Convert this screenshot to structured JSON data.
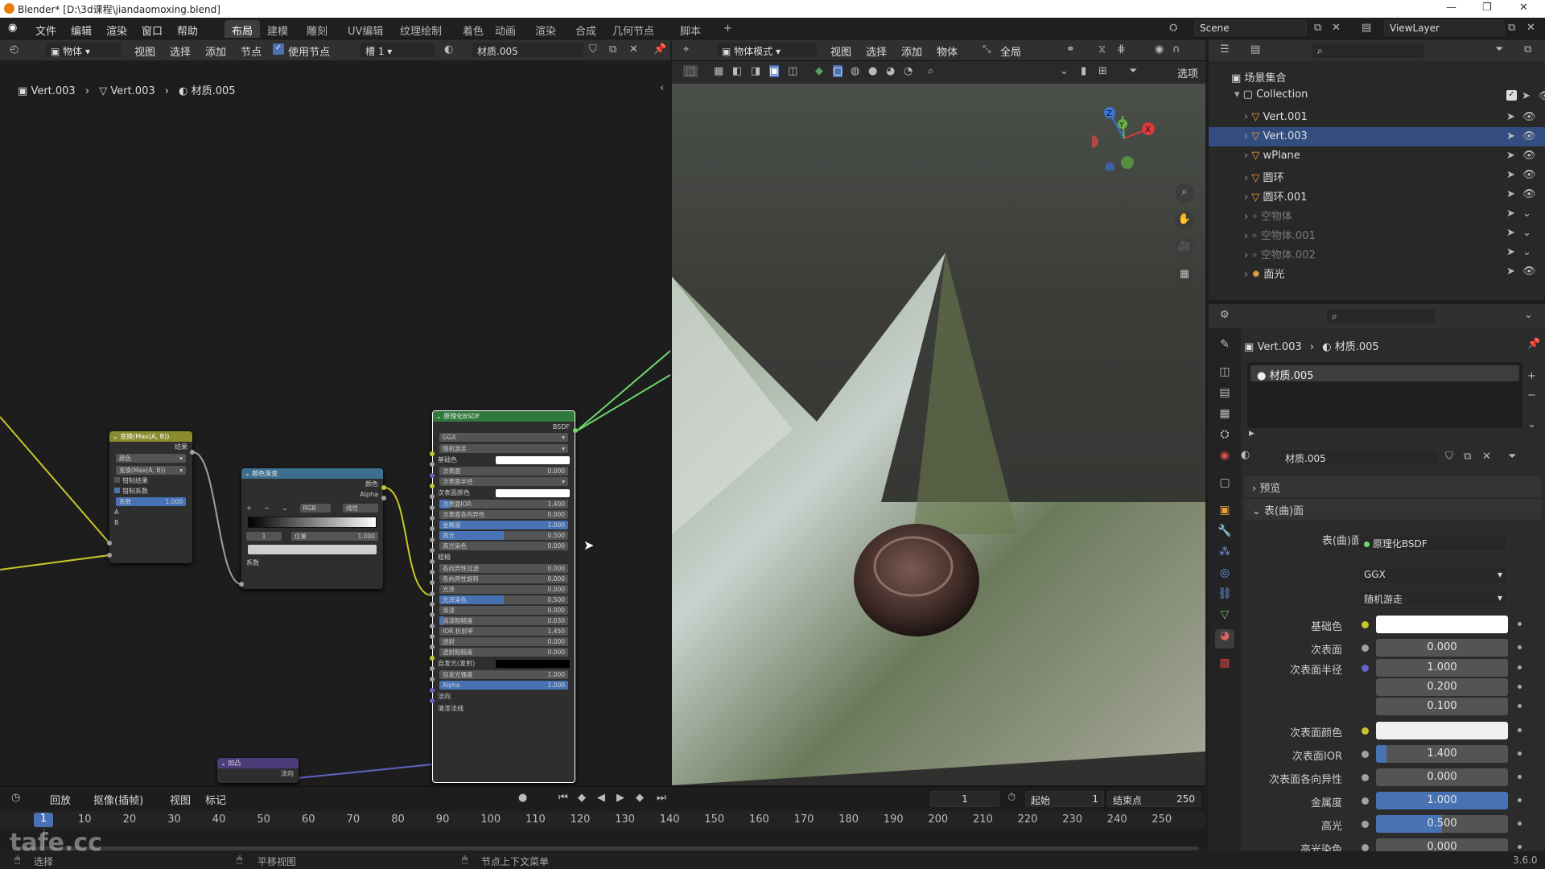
{
  "window": {
    "title": "Blender* [D:\\3d课程\\jiandaomoxing.blend]",
    "minimize": "—",
    "restore": "❐",
    "close": "✕"
  },
  "menu": {
    "items": [
      "文件",
      "编辑",
      "渲染",
      "窗口",
      "帮助"
    ]
  },
  "workspaces": {
    "tabs": [
      "布局",
      "建模",
      "雕刻",
      "UV编辑",
      "纹理绘制",
      "着色",
      "动画",
      "渲染",
      "合成",
      "几何节点",
      "脚本"
    ],
    "active": "布局",
    "add": "+"
  },
  "scene": {
    "label": "Scene",
    "viewlayer": "ViewLayer"
  },
  "node_editor": {
    "header": {
      "type": "物体",
      "menus": [
        "视图",
        "选择",
        "添加",
        "节点"
      ],
      "use_nodes": "使用节点",
      "slot": "槽 1",
      "material": "材质.005"
    },
    "breadcrumb": [
      "Vert.003",
      "Vert.003",
      "材质.005"
    ],
    "math_node": {
      "title": "变换(Max(A, B))",
      "out": "结果",
      "rows": [
        "颜色",
        "变换(Max(A, B))"
      ],
      "check1": "钳制结果",
      "check2": "钳制系数",
      "factor_label": "系数",
      "factor_val": "1.000",
      "in_a": "A",
      "in_b": "B"
    },
    "ramp_node": {
      "title": "颜色渐变",
      "out1": "颜色",
      "out2": "Alpha",
      "mode": "RGB",
      "interp": "线性",
      "index": "1",
      "pos_label": "位置",
      "pos_val": "1.000",
      "in": "系数"
    },
    "bsdf_node": {
      "title": "原理化BSDF",
      "out": "BSDF",
      "dist": "GGX",
      "sss": "随机游走",
      "rows": [
        {
          "l": "基础色",
          "t": "color",
          "c": "#ffffff"
        },
        {
          "l": "次表面",
          "v": "0.000",
          "p": 0
        },
        {
          "l": "次表面半径",
          "t": "menu"
        },
        {
          "l": "次表面颜色",
          "t": "color",
          "c": "#ffffff"
        },
        {
          "l": "次表面IOR",
          "v": "1.400",
          "p": 8
        },
        {
          "l": "次表面各向异性",
          "v": "0.000",
          "p": 0
        },
        {
          "l": "金属度",
          "v": "1.000",
          "p": 100
        },
        {
          "l": "高光",
          "v": "0.500",
          "p": 50
        },
        {
          "l": "高光染色",
          "v": "0.000",
          "p": 0
        },
        {
          "l": "粗糙",
          "t": "label"
        },
        {
          "l": "各向异性过滤",
          "v": "0.000",
          "p": 0
        },
        {
          "l": "各向异性旋转",
          "v": "0.000",
          "p": 0
        },
        {
          "l": "光泽",
          "v": "0.000",
          "p": 0
        },
        {
          "l": "光泽染色",
          "v": "0.500",
          "p": 50
        },
        {
          "l": "清漆",
          "v": "0.000",
          "p": 0
        },
        {
          "l": "清漆粗糙度",
          "v": "0.030",
          "p": 3
        },
        {
          "l": "IOR 折射率",
          "v": "1.450",
          "p": 0
        },
        {
          "l": "透射",
          "v": "0.000",
          "p": 0
        },
        {
          "l": "透射粗糙度",
          "v": "0.000",
          "p": 0
        },
        {
          "l": "自发光(发射)",
          "t": "color",
          "c": "#000000"
        },
        {
          "l": "自发光强度",
          "v": "1.000",
          "p": 0
        },
        {
          "l": "Alpha",
          "v": "1.000",
          "p": 100
        },
        {
          "l": "法向",
          "t": "label"
        },
        {
          "l": "清漆法线",
          "t": "label"
        }
      ]
    },
    "bump_node": {
      "title": "凹凸",
      "out": "法向"
    }
  },
  "viewport": {
    "mode": "物体模式",
    "menus": [
      "视图",
      "选择",
      "添加",
      "物体"
    ],
    "transform": "全局",
    "options": "选项",
    "gizmo": {
      "x": "X",
      "y": "Y",
      "z": "Z"
    }
  },
  "outliner": {
    "root": "场景集合",
    "collection": "Collection",
    "items": [
      {
        "name": "Vert.001",
        "sel": false,
        "dim": false,
        "ico": "mesh"
      },
      {
        "name": "Vert.003",
        "sel": true,
        "dim": false,
        "ico": "mesh"
      },
      {
        "name": "wPlane",
        "sel": false,
        "dim": false,
        "ico": "mesh"
      },
      {
        "name": "圆环",
        "sel": false,
        "dim": false,
        "ico": "mesh"
      },
      {
        "name": "圆环.001",
        "sel": false,
        "dim": false,
        "ico": "mesh"
      },
      {
        "name": "空物体",
        "sel": false,
        "dim": true,
        "ico": "empty"
      },
      {
        "name": "空物体.001",
        "sel": false,
        "dim": true,
        "ico": "empty"
      },
      {
        "name": "空物体.002",
        "sel": false,
        "dim": true,
        "ico": "empty"
      },
      {
        "name": "面光",
        "sel": false,
        "dim": false,
        "ico": "light"
      }
    ]
  },
  "properties": {
    "breadcrumb": [
      "Vert.003",
      "材质.005"
    ],
    "slot": "材质.005",
    "material": "材质.005",
    "preview": "预览",
    "surface_panel": "表(曲)面",
    "surface_label": "表(曲)面",
    "surface_val": "原理化BSDF",
    "dist": "GGX",
    "sss": "随机游走",
    "rows": [
      {
        "l": "基础色",
        "t": "color",
        "c": "#ffffff",
        "dot": "#c7c729"
      },
      {
        "l": "次表面",
        "v": "0.000",
        "p": 0,
        "dot": "#a1a1a1"
      },
      {
        "l": "次表面半径",
        "v": "1.000",
        "p": 0,
        "dot": "#6363c7"
      },
      {
        "l": "",
        "v": "0.200",
        "p": 0
      },
      {
        "l": "",
        "v": "0.100",
        "p": 0
      },
      {
        "l": "次表面颜色",
        "t": "color",
        "c": "#f0f0f0",
        "dot": "#c7c729"
      },
      {
        "l": "次表面IOR",
        "v": "1.400",
        "p": 8,
        "dot": "#a1a1a1"
      },
      {
        "l": "次表面各向异性",
        "v": "0.000",
        "p": 0,
        "dot": "#a1a1a1"
      },
      {
        "l": "金属度",
        "v": "1.000",
        "p": 100,
        "dot": "#a1a1a1"
      },
      {
        "l": "高光",
        "v": "0.500",
        "p": 50,
        "dot": "#a1a1a1"
      },
      {
        "l": "高光染色",
        "v": "0.000",
        "p": 0,
        "dot": "#a1a1a1"
      }
    ]
  },
  "timeline": {
    "menus": [
      "回放",
      "抠像(插帧)",
      "视图",
      "标记"
    ],
    "current": "1",
    "start_label": "起始",
    "start": "1",
    "end_label": "结束点",
    "end": "250",
    "ticks": [
      "10",
      "20",
      "30",
      "40",
      "50",
      "60",
      "70",
      "80",
      "90",
      "100",
      "110",
      "120",
      "130",
      "140",
      "150",
      "160",
      "170",
      "180",
      "190",
      "200",
      "210",
      "220",
      "230",
      "240",
      "250"
    ],
    "playhead": "1"
  },
  "status": {
    "select": "选择",
    "pan": "平移视图",
    "context": "节点上下文菜单",
    "version": "3.6.0",
    "watermark": "tafe.cc"
  }
}
